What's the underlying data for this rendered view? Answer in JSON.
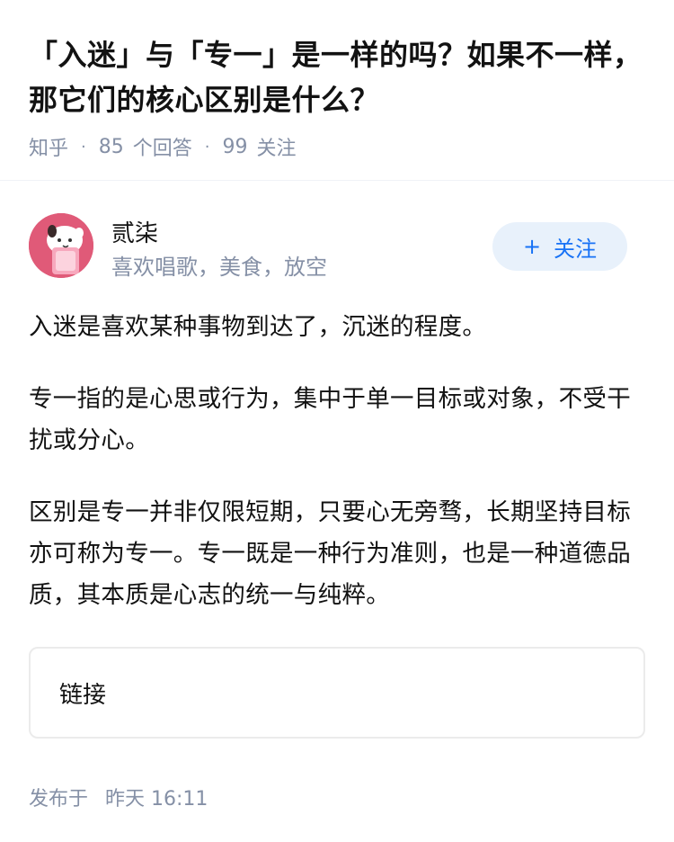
{
  "question": {
    "title": "「入迷」与「专一」是一样的吗？如果不一样，那它们的核心区别是什么？",
    "source": "知乎",
    "answers_count": "85",
    "answers_label": "个回答",
    "followers_count": "99",
    "followers_label": "关注"
  },
  "author": {
    "name": "贰柒",
    "bio": "喜欢唱歌，美食，放空",
    "follow_label": "关注",
    "avatar_color": "#e05a78"
  },
  "answer": {
    "paragraphs": [
      "入迷是喜欢某种事物到达了，沉迷的程度。",
      "专一指的是心思或行为，集中于单一目标或对象，不受干扰或分心。",
      "区别是专一并非仅限短期，只要心无旁骛，长期坚持目标亦可称为专一。专一既是一种行为准则，也是一种道德品质，其本质是心志的统一与纯粹。"
    ],
    "link_label": "链接",
    "publish_label": "发布于",
    "publish_time": "昨天 16:11"
  },
  "colors": {
    "accent": "#1772f6",
    "meta": "#8590a6",
    "follow_bg": "#e8f1fb"
  }
}
